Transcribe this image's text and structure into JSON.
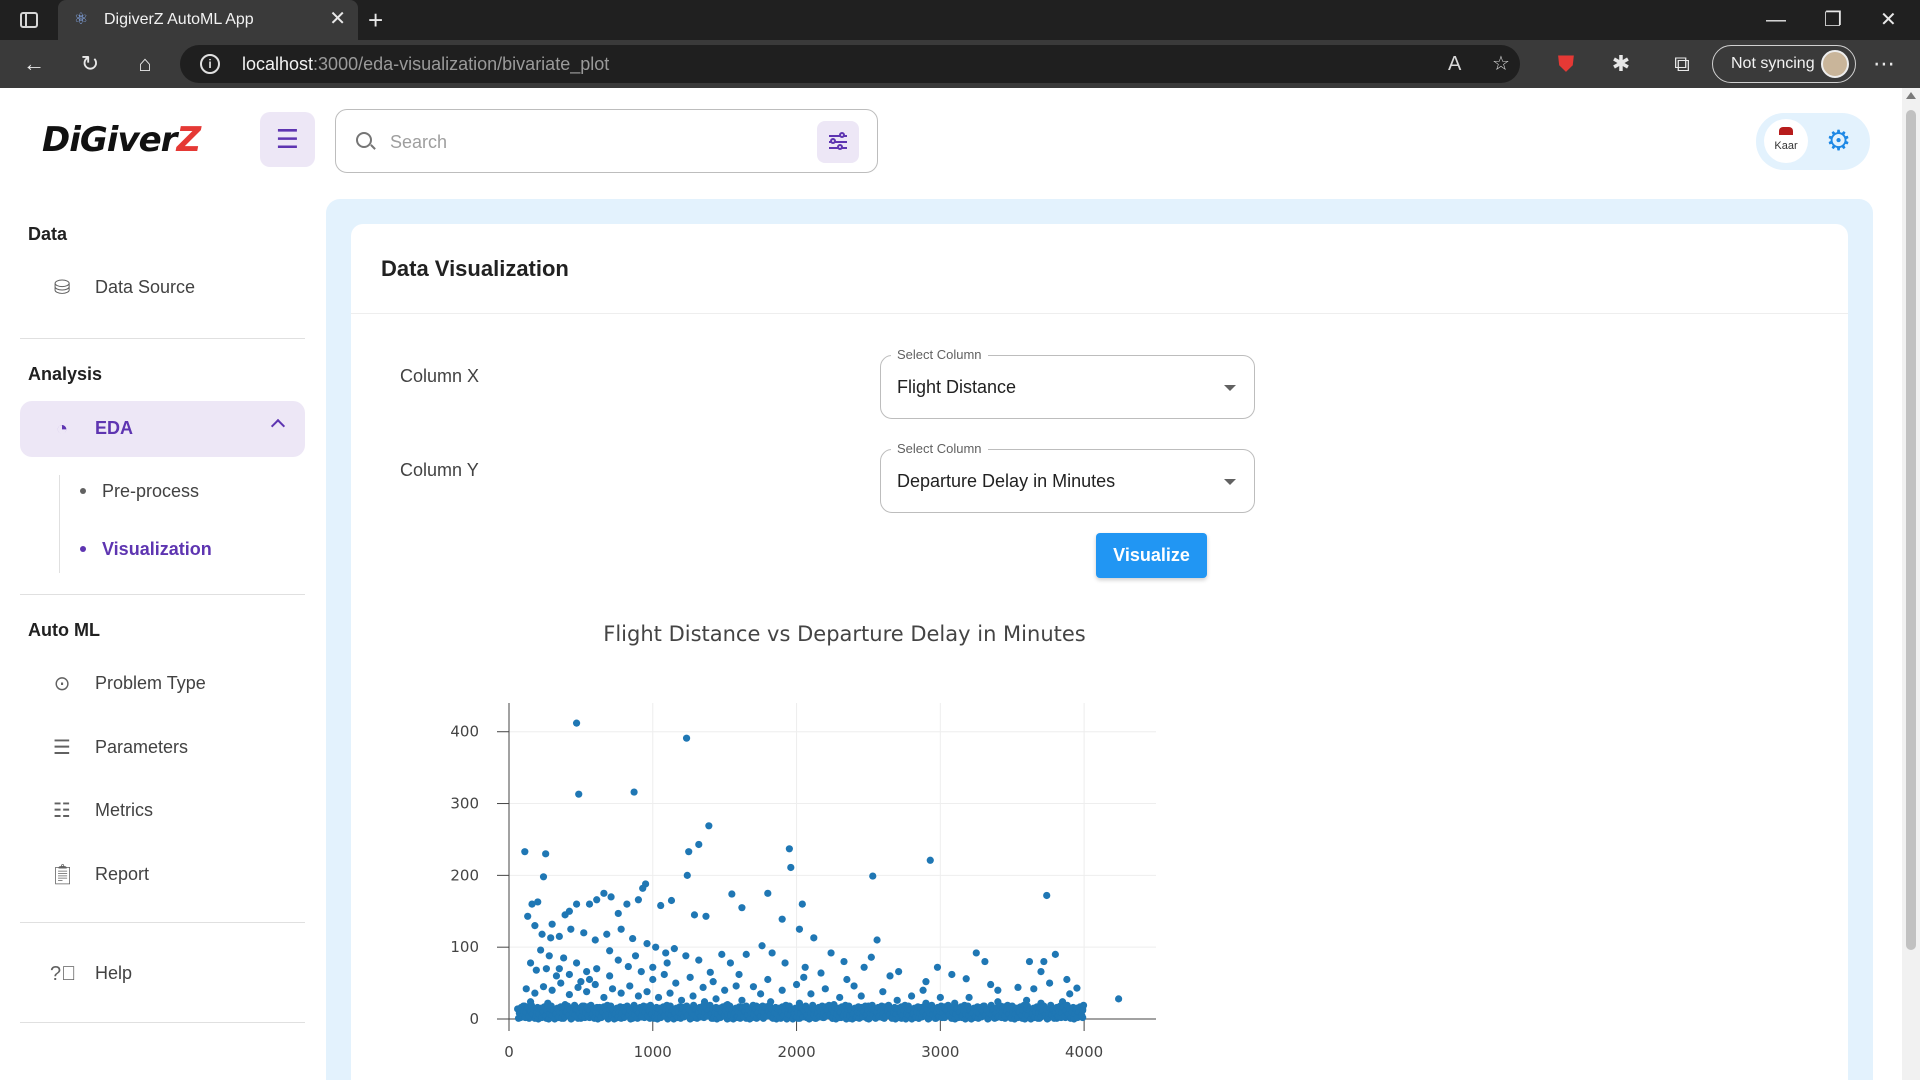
{
  "browser": {
    "tab_title": "DigiverZ AutoML App",
    "url_host": "localhost",
    "url_path": ":3000/eda-visualization/bivariate_plot",
    "sync_label": "Not syncing"
  },
  "header": {
    "logo_text_main": "DiGiver",
    "logo_text_accent": "Z",
    "search_placeholder": "Search",
    "avatar_text": "Kaar"
  },
  "sidebar": {
    "sections": [
      {
        "title": "Data",
        "items": [
          {
            "label": "Data Source",
            "icon": "database-icon"
          }
        ]
      },
      {
        "title": "Analysis",
        "items": [
          {
            "label": "EDA",
            "icon": "pie-chart-icon",
            "active": true
          }
        ]
      },
      {
        "title": "Auto ML",
        "items": [
          {
            "label": "Problem Type",
            "icon": "dots-circle-icon"
          },
          {
            "label": "Parameters",
            "icon": "sliders-icon"
          },
          {
            "label": "Metrics",
            "icon": "list-icon"
          },
          {
            "label": "Report",
            "icon": "clipboard-icon"
          }
        ]
      }
    ],
    "eda_subitems": [
      {
        "label": "Pre-process"
      },
      {
        "label": "Visualization",
        "active": true
      }
    ],
    "help_label": "Help"
  },
  "main": {
    "title": "Data Visualization",
    "column_x_label": "Column X",
    "column_y_label": "Column Y",
    "select_float_label": "Select Column",
    "column_x_value": "Flight Distance",
    "column_y_value": "Departure Delay in Minutes",
    "visualize_label": "Visualize"
  },
  "colors": {
    "accent": "#5e35b1",
    "primary_button": "#2196f3",
    "point": "#1f77b4",
    "main_bg": "#e3f2fd"
  },
  "chart_data": {
    "type": "scatter",
    "title": "Flight Distance vs Departure Delay in Minutes",
    "xlabel": "",
    "ylabel": "",
    "xlim": [
      0,
      4500
    ],
    "ylim": [
      0,
      440
    ],
    "x_ticks": [
      0,
      1000,
      2000,
      3000,
      4000
    ],
    "y_ticks": [
      0,
      100,
      200,
      300,
      400
    ],
    "grid": true,
    "points": [
      [
        470,
        412
      ],
      [
        1235,
        391
      ],
      [
        485,
        313
      ],
      [
        870,
        316
      ],
      [
        1390,
        269
      ],
      [
        1320,
        243
      ],
      [
        1950,
        237
      ],
      [
        1250,
        233
      ],
      [
        110,
        233
      ],
      [
        255,
        230
      ],
      [
        2930,
        221
      ],
      [
        1960,
        211
      ],
      [
        1240,
        200
      ],
      [
        2530,
        199
      ],
      [
        240,
        198
      ],
      [
        3740,
        172
      ],
      [
        2040,
        160
      ],
      [
        1550,
        174
      ],
      [
        1620,
        155
      ],
      [
        1800,
        175
      ],
      [
        1900,
        139
      ],
      [
        1370,
        143
      ],
      [
        1290,
        145
      ],
      [
        2020,
        125
      ],
      [
        2120,
        113
      ],
      [
        2560,
        110
      ],
      [
        1130,
        165
      ],
      [
        1055,
        158
      ],
      [
        950,
        188
      ],
      [
        930,
        182
      ],
      [
        900,
        166
      ],
      [
        820,
        160
      ],
      [
        760,
        147
      ],
      [
        710,
        170
      ],
      [
        660,
        175
      ],
      [
        610,
        166
      ],
      [
        560,
        160
      ],
      [
        470,
        160
      ],
      [
        420,
        150
      ],
      [
        390,
        145
      ],
      [
        300,
        132
      ],
      [
        200,
        163
      ],
      [
        160,
        160
      ],
      [
        130,
        143
      ],
      [
        180,
        130
      ],
      [
        230,
        118
      ],
      [
        290,
        113
      ],
      [
        350,
        115
      ],
      [
        430,
        125
      ],
      [
        520,
        120
      ],
      [
        600,
        110
      ],
      [
        680,
        118
      ],
      [
        780,
        125
      ],
      [
        860,
        112
      ],
      [
        960,
        105
      ],
      [
        1020,
        100
      ],
      [
        1090,
        92
      ],
      [
        1150,
        98
      ],
      [
        1230,
        88
      ],
      [
        1320,
        82
      ],
      [
        1480,
        90
      ],
      [
        1540,
        78
      ],
      [
        1650,
        90
      ],
      [
        1760,
        102
      ],
      [
        1830,
        92
      ],
      [
        1920,
        78
      ],
      [
        2060,
        72
      ],
      [
        2170,
        64
      ],
      [
        2240,
        92
      ],
      [
        2330,
        80
      ],
      [
        2470,
        72
      ],
      [
        2520,
        86
      ],
      [
        2650,
        60
      ],
      [
        2710,
        66
      ],
      [
        2880,
        40
      ],
      [
        2980,
        72
      ],
      [
        3080,
        62
      ],
      [
        3180,
        56
      ],
      [
        3250,
        92
      ],
      [
        3310,
        80
      ],
      [
        3400,
        40
      ],
      [
        3540,
        44
      ],
      [
        3620,
        80
      ],
      [
        3700,
        66
      ],
      [
        3720,
        80
      ],
      [
        3760,
        50
      ],
      [
        3800,
        90
      ],
      [
        3880,
        55
      ],
      [
        3950,
        43
      ],
      [
        4240,
        28
      ],
      [
        150,
        78
      ],
      [
        190,
        68
      ],
      [
        260,
        70
      ],
      [
        330,
        60
      ],
      [
        380,
        85
      ],
      [
        470,
        78
      ],
      [
        540,
        66
      ],
      [
        610,
        70
      ],
      [
        700,
        60
      ],
      [
        760,
        82
      ],
      [
        830,
        73
      ],
      [
        920,
        66
      ],
      [
        1000,
        55
      ],
      [
        1080,
        62
      ],
      [
        1160,
        50
      ],
      [
        1260,
        58
      ],
      [
        1350,
        44
      ],
      [
        1420,
        52
      ],
      [
        1500,
        40
      ],
      [
        1580,
        46
      ],
      [
        1700,
        45
      ],
      [
        1800,
        55
      ],
      [
        1900,
        40
      ],
      [
        2000,
        48
      ],
      [
        2100,
        35
      ],
      [
        2200,
        42
      ],
      [
        2300,
        30
      ],
      [
        2400,
        46
      ],
      [
        2600,
        38
      ],
      [
        2700,
        26
      ],
      [
        2800,
        32
      ],
      [
        2900,
        22
      ],
      [
        3000,
        30
      ],
      [
        3100,
        22
      ],
      [
        3200,
        30
      ],
      [
        3300,
        18
      ],
      [
        3400,
        24
      ],
      [
        3500,
        18
      ],
      [
        3600,
        26
      ],
      [
        3700,
        22
      ],
      [
        3850,
        24
      ],
      [
        3990,
        14
      ],
      [
        120,
        42
      ],
      [
        180,
        36
      ],
      [
        240,
        45
      ],
      [
        300,
        40
      ],
      [
        360,
        50
      ],
      [
        420,
        34
      ],
      [
        480,
        44
      ],
      [
        540,
        38
      ],
      [
        600,
        48
      ],
      [
        660,
        30
      ],
      [
        720,
        42
      ],
      [
        780,
        36
      ],
      [
        840,
        46
      ],
      [
        900,
        32
      ],
      [
        960,
        38
      ],
      [
        1040,
        30
      ],
      [
        1120,
        36
      ],
      [
        1200,
        26
      ],
      [
        1280,
        32
      ],
      [
        1360,
        24
      ],
      [
        1440,
        28
      ],
      [
        1520,
        20
      ],
      [
        1620,
        26
      ],
      [
        1720,
        18
      ],
      [
        1820,
        24
      ],
      [
        1920,
        16
      ],
      [
        2020,
        22
      ],
      [
        2140,
        14
      ],
      [
        2260,
        20
      ],
      [
        2380,
        12
      ],
      [
        2500,
        18
      ],
      [
        2620,
        10
      ],
      [
        2740,
        14
      ],
      [
        2860,
        8
      ],
      [
        2980,
        12
      ],
      [
        3120,
        8
      ],
      [
        3260,
        12
      ],
      [
        3380,
        6
      ],
      [
        3520,
        10
      ],
      [
        3660,
        6
      ],
      [
        3800,
        8
      ],
      [
        3960,
        4
      ],
      [
        100,
        18
      ],
      [
        150,
        24
      ],
      [
        210,
        14
      ],
      [
        270,
        22
      ],
      [
        330,
        12
      ],
      [
        390,
        20
      ],
      [
        450,
        10
      ],
      [
        510,
        18
      ],
      [
        570,
        8
      ],
      [
        630,
        16
      ],
      [
        690,
        6
      ],
      [
        750,
        14
      ],
      [
        810,
        4
      ],
      [
        870,
        12
      ],
      [
        930,
        3
      ],
      [
        990,
        10
      ],
      [
        1050,
        2
      ],
      [
        1110,
        8
      ],
      [
        1170,
        3
      ],
      [
        1230,
        6
      ],
      [
        1290,
        2
      ],
      [
        1350,
        5
      ],
      [
        1410,
        1
      ],
      [
        1470,
        4
      ],
      [
        1530,
        1
      ],
      [
        1590,
        3
      ],
      [
        1650,
        1
      ],
      [
        1710,
        2
      ],
      [
        1770,
        1
      ],
      [
        1830,
        2
      ],
      [
        1890,
        1
      ],
      [
        1950,
        2
      ],
      [
        2010,
        1
      ],
      [
        2070,
        2
      ],
      [
        2130,
        1
      ],
      [
        2190,
        2
      ],
      [
        2250,
        1
      ],
      [
        2310,
        2
      ],
      [
        2370,
        1
      ],
      [
        2430,
        2
      ],
      [
        2490,
        1
      ],
      [
        2550,
        2
      ],
      [
        2610,
        1
      ],
      [
        2670,
        2
      ],
      [
        2730,
        1
      ],
      [
        2790,
        2
      ],
      [
        2850,
        1
      ],
      [
        2910,
        2
      ],
      [
        2970,
        1
      ],
      [
        3030,
        2
      ],
      [
        3090,
        1
      ],
      [
        3150,
        2
      ],
      [
        3210,
        1
      ],
      [
        3270,
        2
      ],
      [
        3330,
        1
      ],
      [
        3390,
        2
      ],
      [
        3450,
        1
      ],
      [
        3510,
        2
      ],
      [
        3570,
        1
      ],
      [
        3630,
        2
      ],
      [
        3690,
        1
      ],
      [
        3750,
        2
      ],
      [
        3810,
        1
      ],
      [
        3870,
        2
      ],
      [
        3930,
        1
      ],
      [
        3990,
        2
      ],
      [
        80,
        2
      ],
      [
        140,
        1
      ],
      [
        200,
        3
      ],
      [
        260,
        1
      ],
      [
        320,
        4
      ],
      [
        380,
        1
      ],
      [
        440,
        3
      ],
      [
        500,
        1
      ],
      [
        560,
        2
      ],
      [
        620,
        1
      ],
      [
        680,
        3
      ],
      [
        740,
        1
      ],
      [
        800,
        2
      ],
      [
        860,
        1
      ],
      [
        920,
        3
      ],
      [
        980,
        1
      ],
      [
        500,
        52
      ],
      [
        560,
        55
      ],
      [
        420,
        62
      ],
      [
        350,
        70
      ],
      [
        280,
        88
      ],
      [
        220,
        96
      ],
      [
        700,
        95
      ],
      [
        880,
        88
      ],
      [
        1000,
        72
      ],
      [
        1100,
        78
      ],
      [
        1400,
        65
      ],
      [
        1600,
        62
      ],
      [
        1750,
        35
      ],
      [
        2050,
        58
      ],
      [
        2350,
        55
      ],
      [
        2450,
        32
      ],
      [
        2900,
        52
      ],
      [
        3350,
        48
      ],
      [
        3650,
        42
      ],
      [
        3900,
        35
      ]
    ]
  }
}
